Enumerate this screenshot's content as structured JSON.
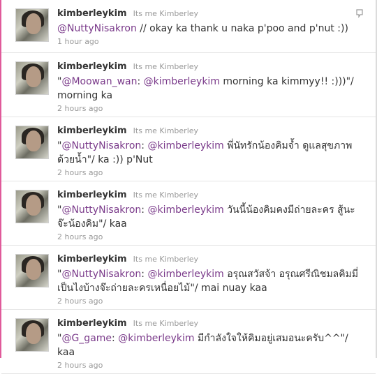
{
  "tweets": [
    {
      "username": "kimberleykim",
      "fullname": "Its me Kimberley",
      "text_parts": [
        {
          "t": "@NuttyNisakron",
          "m": true
        },
        {
          "t": " // okay ka thank u naka p'poo and p'nut :))",
          "m": false
        }
      ],
      "time": "1 hour ago"
    },
    {
      "username": "kimberleykim",
      "fullname": "Its me Kimberley",
      "text_parts": [
        {
          "t": "\"",
          "m": false
        },
        {
          "t": "@Moowan_wan",
          "m": true
        },
        {
          "t": ": ",
          "m": false
        },
        {
          "t": "@kimberleykim",
          "m": true
        },
        {
          "t": " morning ka kimmyy!! :)))\"/ morning ka",
          "m": false
        }
      ],
      "time": "2 hours ago"
    },
    {
      "username": "kimberleykim",
      "fullname": "Its me Kimberley",
      "text_parts": [
        {
          "t": "\"",
          "m": false
        },
        {
          "t": "@NuttyNisakron",
          "m": true
        },
        {
          "t": ": ",
          "m": false
        },
        {
          "t": "@kimberleykim",
          "m": true
        },
        {
          "t": " พี่นัทรักน้องคิมจ้ำ ดูแลสุขภาพด้วยน้ำ\"/ ka :)) p'Nut",
          "m": false
        }
      ],
      "time": "2 hours ago"
    },
    {
      "username": "kimberleykim",
      "fullname": "Its me Kimberley",
      "text_parts": [
        {
          "t": "\"",
          "m": false
        },
        {
          "t": "@NuttyNisakron",
          "m": true
        },
        {
          "t": ": ",
          "m": false
        },
        {
          "t": "@kimberleykim",
          "m": true
        },
        {
          "t": " วันนี้น้องคิมคงมีถ่ายละคร สู้นะจ๊ะน้องคิม\"/ kaa",
          "m": false
        }
      ],
      "time": "2 hours ago"
    },
    {
      "username": "kimberleykim",
      "fullname": "Its me Kimberley",
      "text_parts": [
        {
          "t": "\"",
          "m": false
        },
        {
          "t": "@NuttyNisakron",
          "m": true
        },
        {
          "t": ": ",
          "m": false
        },
        {
          "t": "@kimberleykim",
          "m": true
        },
        {
          "t": " อรุณสวัสจ้า อรุณศรีณิชมลคิมมี่ เป็นไงบ้างจ๊ะถ่ายละครเหนื่อยไม้\"/ mai nuay kaa",
          "m": false
        }
      ],
      "time": "2 hours ago"
    },
    {
      "username": "kimberleykim",
      "fullname": "Its me Kimberley",
      "text_parts": [
        {
          "t": "\"",
          "m": false
        },
        {
          "t": "@G_game",
          "m": true
        },
        {
          "t": ": ",
          "m": false
        },
        {
          "t": "@kimberleykim",
          "m": true
        },
        {
          "t": " มีกำลังใจให้คิมอยู่เสมอนะครับ^^\"/ kaa",
          "m": false
        }
      ],
      "time": "2 hours ago"
    }
  ],
  "colors": {
    "mention": "#7a3a8a",
    "text": "#333333",
    "muted": "#999999",
    "accent": "#e05a9a"
  },
  "icons": {
    "reply": "reply-icon"
  }
}
